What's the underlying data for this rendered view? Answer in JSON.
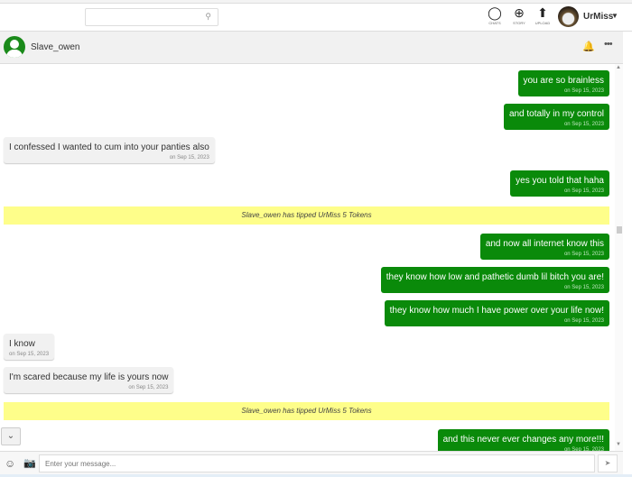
{
  "nav": {
    "search_placeholder": "",
    "chats": "CHATS",
    "story": "STORY",
    "upload": "UPLOAD",
    "username": "UrMiss"
  },
  "chat": {
    "contact": "Slave_owen"
  },
  "messages": [
    {
      "dir": "sent",
      "text": "you are so brainless",
      "date": "on Sep 15, 2023"
    },
    {
      "dir": "sent",
      "text": "and totally in my control",
      "date": "on Sep 15, 2023"
    },
    {
      "dir": "recv",
      "text": "I confessed I wanted to cum into your panties also",
      "date": "on Sep 15, 2023"
    },
    {
      "dir": "sent",
      "text": "yes you told that haha",
      "date": "on Sep 15, 2023"
    },
    {
      "dir": "tip",
      "text": "Slave_owen has tipped UrMiss 5 Tokens"
    },
    {
      "dir": "sent",
      "text": "and now all internet know this",
      "date": "on Sep 15, 2023"
    },
    {
      "dir": "sent",
      "text": "they know how low and pathetic dumb lil bitch you are!",
      "date": "on Sep 15, 2023"
    },
    {
      "dir": "sent",
      "text": "they know how much I have power over your life now!",
      "date": "on Sep 15, 2023"
    },
    {
      "dir": "recv",
      "text": "I know",
      "date": "on Sep 15, 2023"
    },
    {
      "dir": "recv",
      "text": "I'm scared because my life is yours now",
      "date": "on Sep 15, 2023"
    },
    {
      "dir": "tip",
      "text": "Slave_owen has tipped UrMiss 5 Tokens"
    },
    {
      "dir": "sent",
      "text": "and this never ever changes any more!!!",
      "date": "on Sep 15, 2023"
    }
  ],
  "composer": {
    "placeholder": "Enter your message..."
  },
  "colors": {
    "sent": "#0a8a0a",
    "tip": "#fefe8a"
  }
}
